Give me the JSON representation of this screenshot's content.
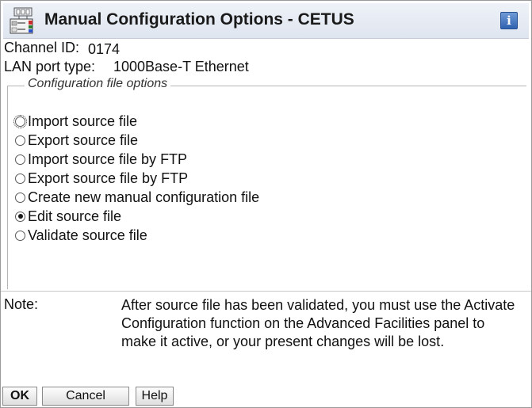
{
  "window": {
    "title": "Manual Configuration Options - CETUS",
    "info_button": "i"
  },
  "fields": {
    "channel_id_label": "Channel ID:",
    "channel_id_value": "0174",
    "lan_port_type_label": "LAN port type:",
    "lan_port_type_value": "1000Base-T Ethernet"
  },
  "config_options": {
    "legend": "Configuration file options",
    "options": [
      {
        "label": "Import source file",
        "selected": false,
        "focused": true
      },
      {
        "label": "Export source file",
        "selected": false
      },
      {
        "label": "Import source file by FTP",
        "selected": false
      },
      {
        "label": "Export source file by FTP",
        "selected": false
      },
      {
        "label": "Create new manual configuration file",
        "selected": false
      },
      {
        "label": "Edit source file",
        "selected": true
      },
      {
        "label": "Validate source file",
        "selected": false
      }
    ]
  },
  "note": {
    "label": "Note:",
    "text": "After source file has been validated, you must use the Activate Configuration function on the Advanced Facilities panel to make it active, or your present changes will be lost."
  },
  "buttons": {
    "ok": "OK",
    "cancel": "Cancel",
    "help": "Help"
  },
  "colors": {
    "titlebar_top": "#eef2f8",
    "titlebar_bottom": "#dfe5ef",
    "info_blue": "#2f62b0"
  },
  "icons": {
    "app": "hardware-config-icon",
    "info": "info-icon"
  }
}
